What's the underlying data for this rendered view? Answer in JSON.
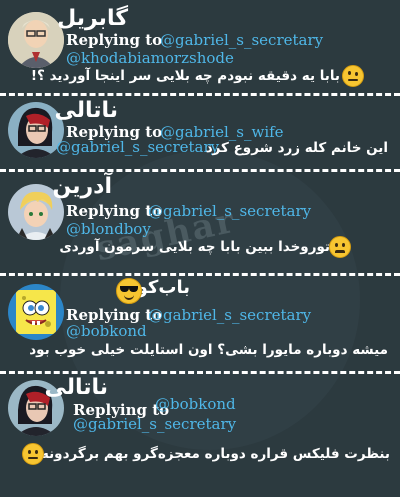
{
  "posts": [
    {
      "name": "گابریل",
      "reply_label": "Replying to",
      "mentions": [
        "@gabriel_s_secretary",
        "@khodabiamorzshode"
      ],
      "text": "بابا یه دقیقه نبودم چه بلایی سر اینجا آوردید ؟!",
      "emoji": "raised-eyebrow-emoji"
    },
    {
      "name": "ناتالی",
      "reply_label": "Replying to",
      "mentions": [
        "@gabriel_s_wife",
        "@gabriel_s_secretary"
      ],
      "text": "این خانم کله زرد شروع کرد",
      "emoji": ""
    },
    {
      "name": "آدرین",
      "reply_label": "Replying to",
      "mentions": [
        "@gabriel_s_secretary",
        "@blondboy"
      ],
      "text": "توروخدا ببین بابا چه بلایی سرمون آوردی",
      "emoji": "worried-emoji"
    },
    {
      "name": "باب‌کوند",
      "reply_label": "Replying to",
      "mentions": [
        "@gabriel_s_secretary",
        "@bobkond"
      ],
      "text": "میشه دوباره مایورا بشی؟ اون استایلت خیلی خوب بود",
      "emoji": "sunglasses-emoji"
    },
    {
      "name": "ناتالی",
      "reply_label": "Replying to",
      "mentions": [
        "@bobkond",
        "@gabriel_s_secretary"
      ],
      "text": "بنظرت فلیکس قراره دوباره معجزه‌گرو بهم برگردونه؟",
      "emoji": "neutral-face-emoji"
    }
  ],
  "watermark": "saghar",
  "colors": {
    "background": "#2c3a3f",
    "mention": "#4fb7e8",
    "emoji": "#f7c531"
  }
}
